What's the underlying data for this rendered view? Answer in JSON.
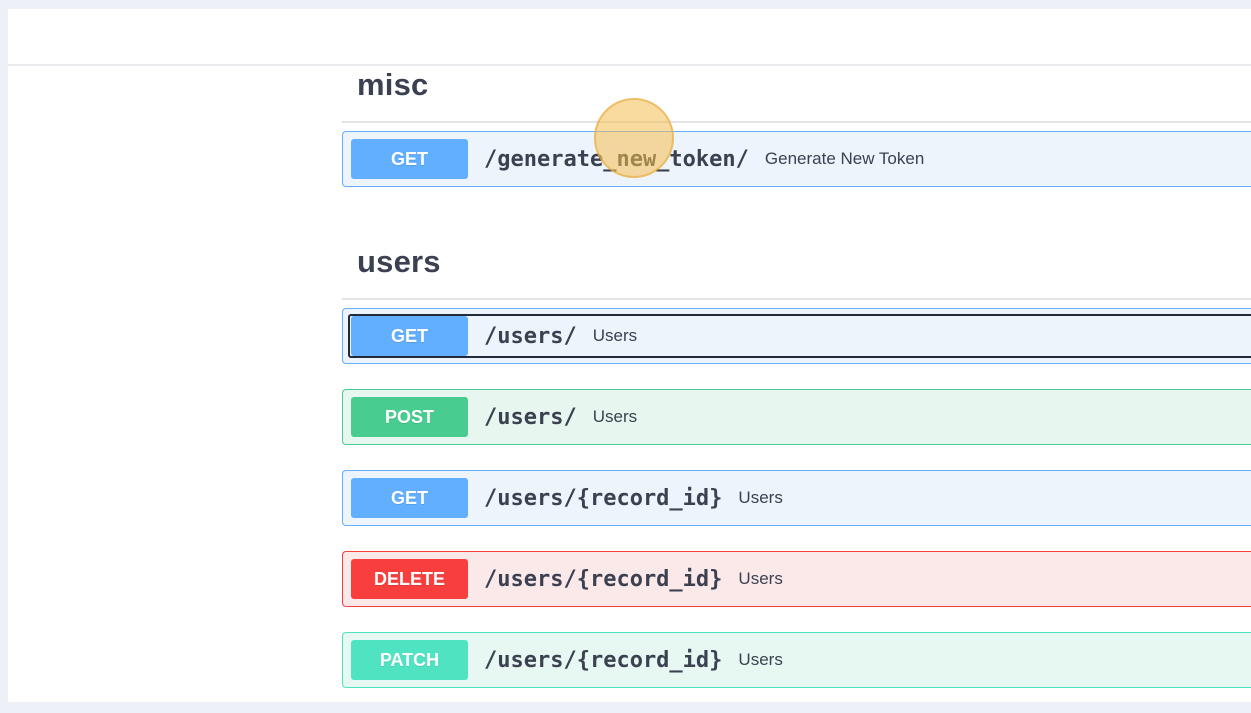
{
  "sections": [
    {
      "title": "misc",
      "operations": [
        {
          "method": "GET",
          "path": "/generate_new_token/",
          "summary": "Generate New Token"
        }
      ]
    },
    {
      "title": "users",
      "operations": [
        {
          "method": "GET",
          "path": "/users/",
          "summary": "Users"
        },
        {
          "method": "POST",
          "path": "/users/",
          "summary": "Users"
        },
        {
          "method": "GET",
          "path": "/users/{record_id}",
          "summary": "Users"
        },
        {
          "method": "DELETE",
          "path": "/users/{record_id}",
          "summary": "Users"
        },
        {
          "method": "PATCH",
          "path": "/users/{record_id}",
          "summary": "Users"
        }
      ]
    }
  ],
  "colors": {
    "get": "#61affe",
    "post": "#49cc90",
    "delete": "#f93e3e",
    "patch": "#50e3c2",
    "text": "#3b4151"
  }
}
